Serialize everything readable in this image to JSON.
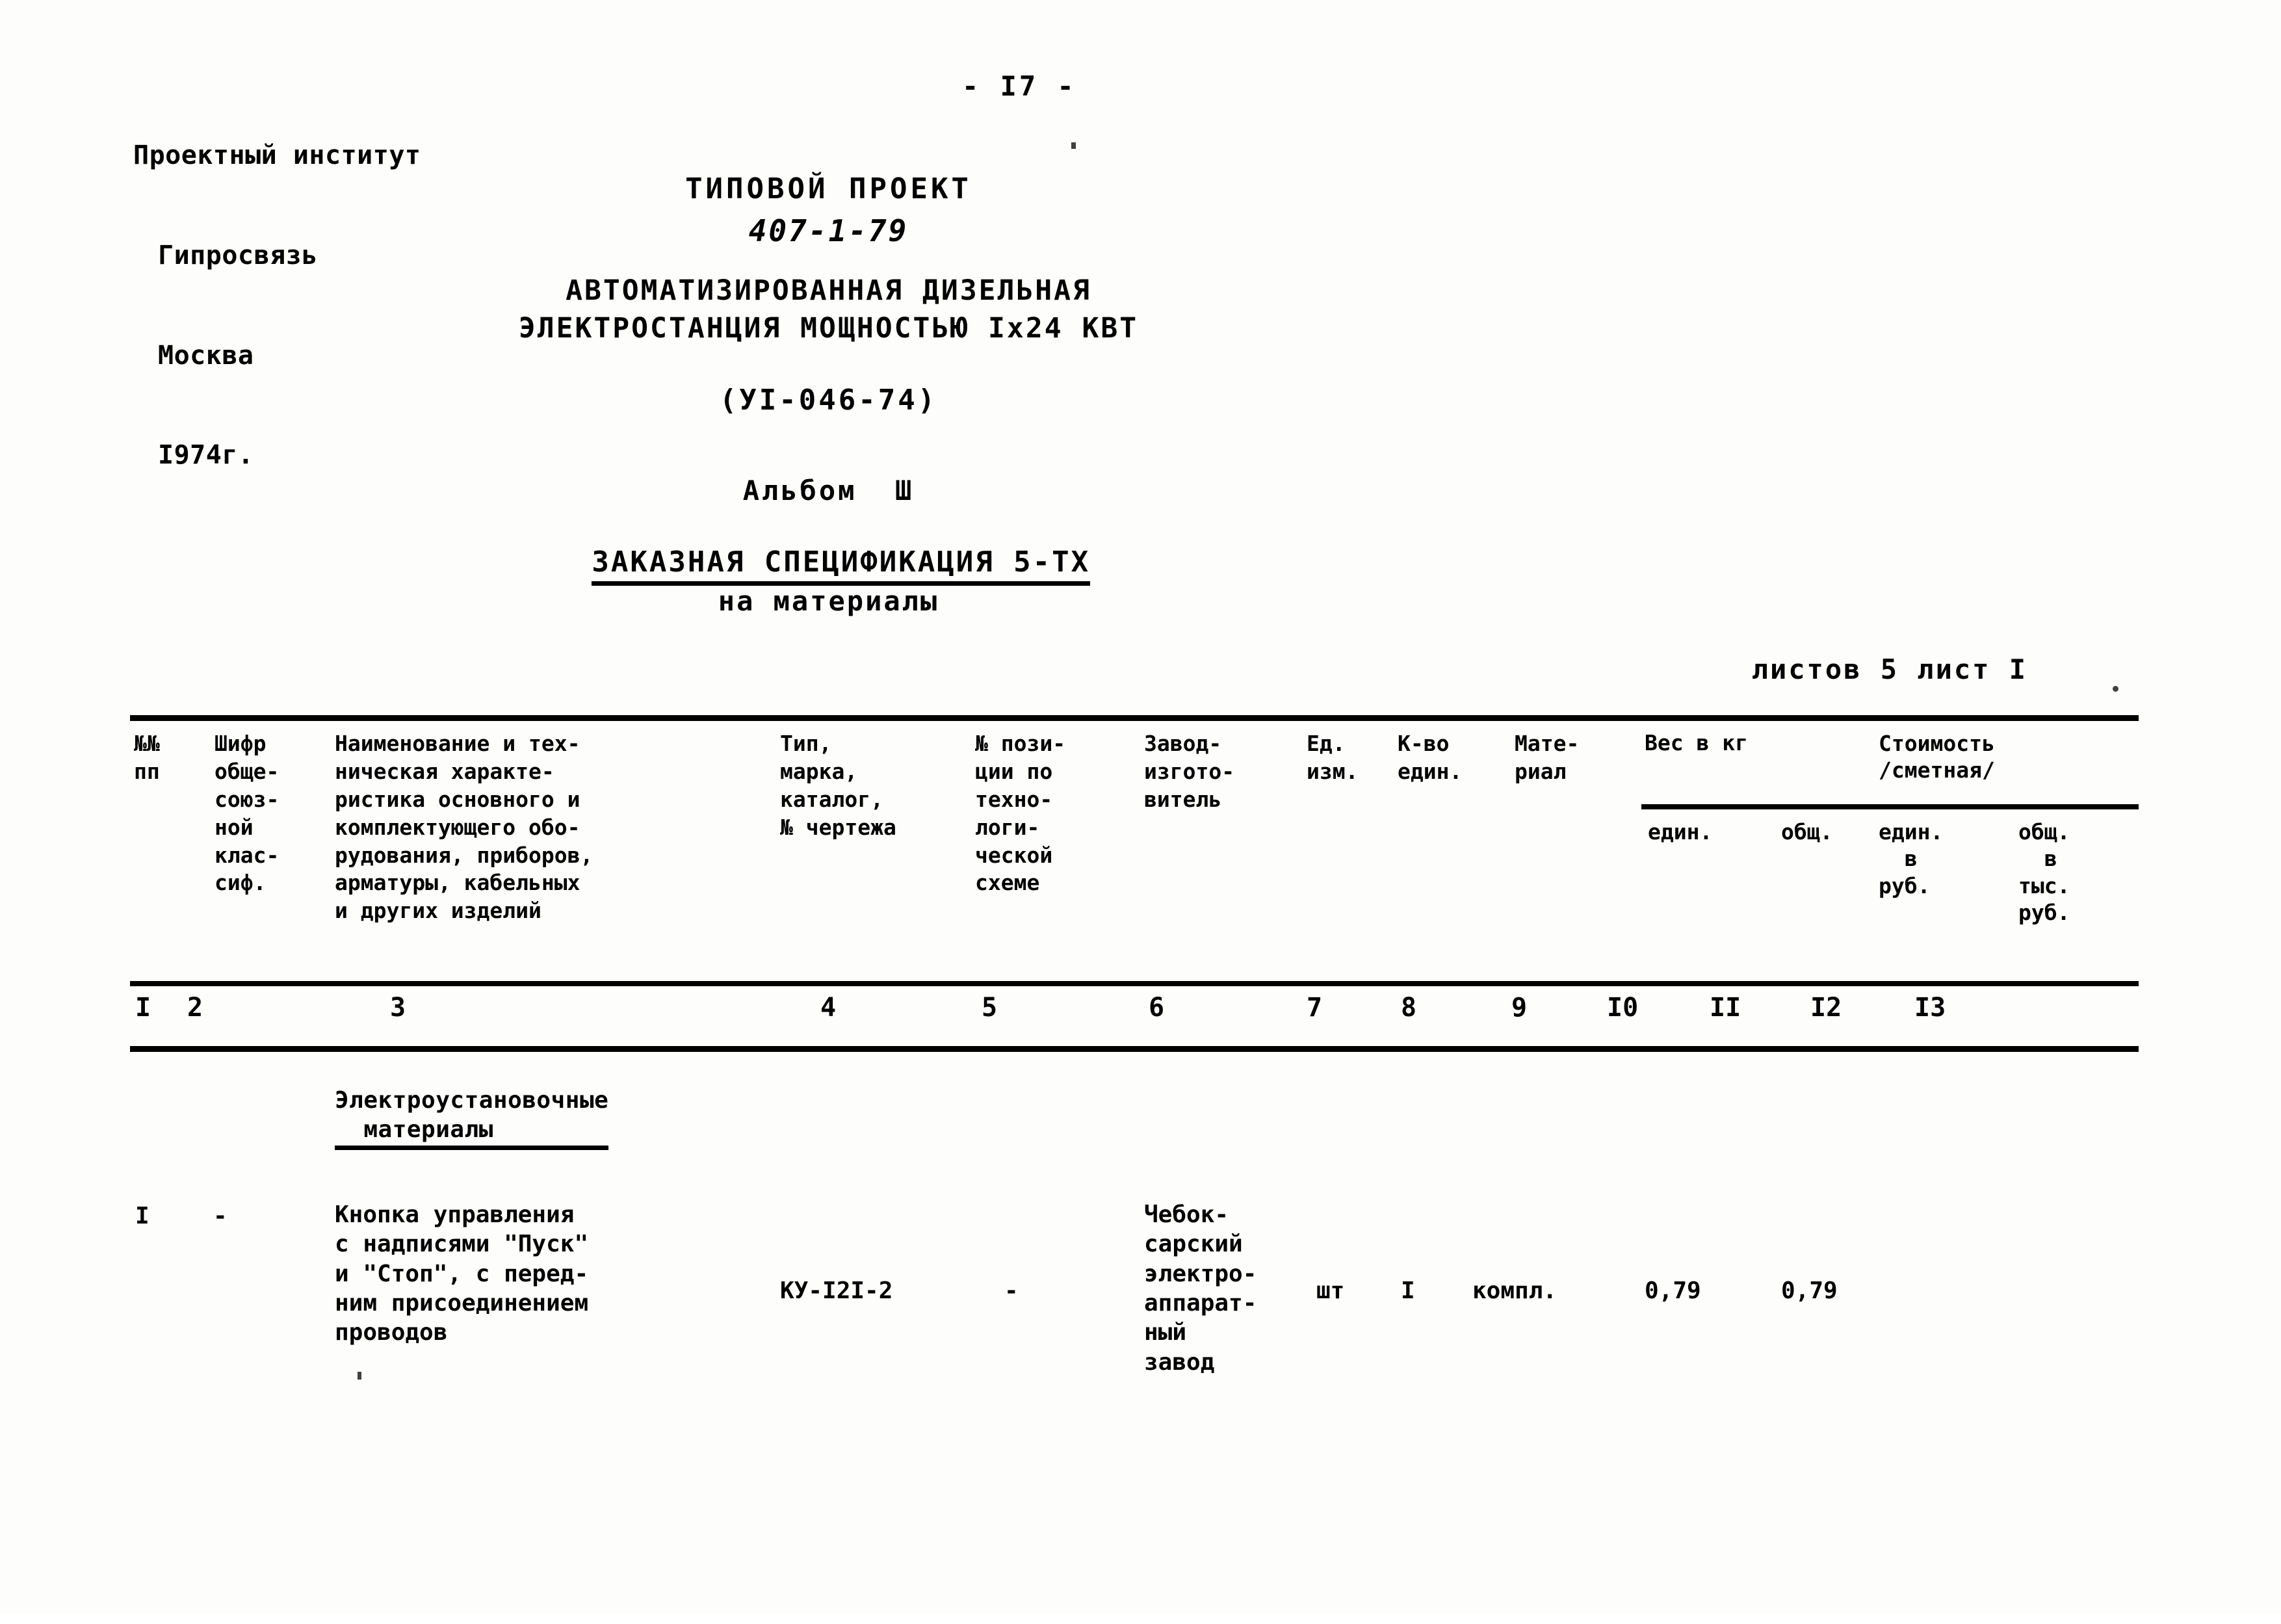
{
  "organization": {
    "line1": "Проектный институт",
    "line2": "Гипросвязь",
    "line3": "Москва",
    "line4": "I974г."
  },
  "page_number": "- I7 -",
  "title": {
    "main": "ТИПОВОЙ ПРОЕКТ",
    "project_code": "407-1-79",
    "subtitle_1": "АВТОМАТИЗИРОВАННАЯ ДИЗЕЛЬНАЯ",
    "subtitle_2": "ЭЛЕКТРОСТАНЦИЯ МОЩНОСТЬЮ Iх24 КВТ",
    "doc_code": "(УI-046-74)",
    "album": "Альбом  Ш",
    "spec_title": "ЗАКАЗНАЯ СПЕЦИФИКАЦИЯ 5-ТХ",
    "spec_subtitle": "на материалы"
  },
  "sheets_info": "листов 5 лист I",
  "table": {
    "headers": {
      "col1": "№№\nпп",
      "col2": "Шифр\nобще-\nсоюз-\nной\nклас-\nсиф.",
      "col3": "Наименование и тех-\nническая характе-\nристика основного и\nкомплектующего обо-\nрудования, приборов,\nарматуры, кабельных\nи других изделий",
      "col4": "Тип,\nмарка,\nкаталог,\n№ чертежа",
      "col5": "№ пози-\nции по\nтехно-\nлоги-\nческой\nсхеме",
      "col6": "Завод-\nизгото-\nвитель",
      "col7": "Ед.\nизм.",
      "col8": "К-во\nедин.",
      "col9": "Мате-\nриал",
      "group_weight": "Вес в кг",
      "group_cost": "Стоимость\n/сметная/",
      "sub_weight_unit": "един.",
      "sub_weight_total": "общ.",
      "sub_cost_unit": "един.\n  в\nруб.",
      "sub_cost_total": "общ.\n  в\nтыс.\nруб."
    },
    "column_numbers": [
      "I",
      "2",
      "3",
      "4",
      "5",
      "6",
      "7",
      "8",
      "9",
      "I0",
      "II",
      "I2",
      "I3"
    ],
    "section_heading": "Электроустановочные\n  материалы",
    "rows": [
      {
        "num": "I",
        "classifier_code": "-",
        "name": "Кнопка управления\nс надписями \"Пуск\"\nи \"Стоп\", с перед-\nним присоединением\nпроводов",
        "type_mark": "КУ-I2I-2",
        "position_no": "-",
        "manufacturer": "Чебок-\nсарский\nэлектро-\nаппарат-\nный\nзавод",
        "unit": "шт",
        "quantity": "I",
        "material": "компл.",
        "weight_unit": "0,79",
        "weight_total": "0,79",
        "cost_unit": "",
        "cost_total": ""
      }
    ]
  },
  "colors": {
    "ink": "#000000",
    "paper": "#fdfdfb"
  }
}
